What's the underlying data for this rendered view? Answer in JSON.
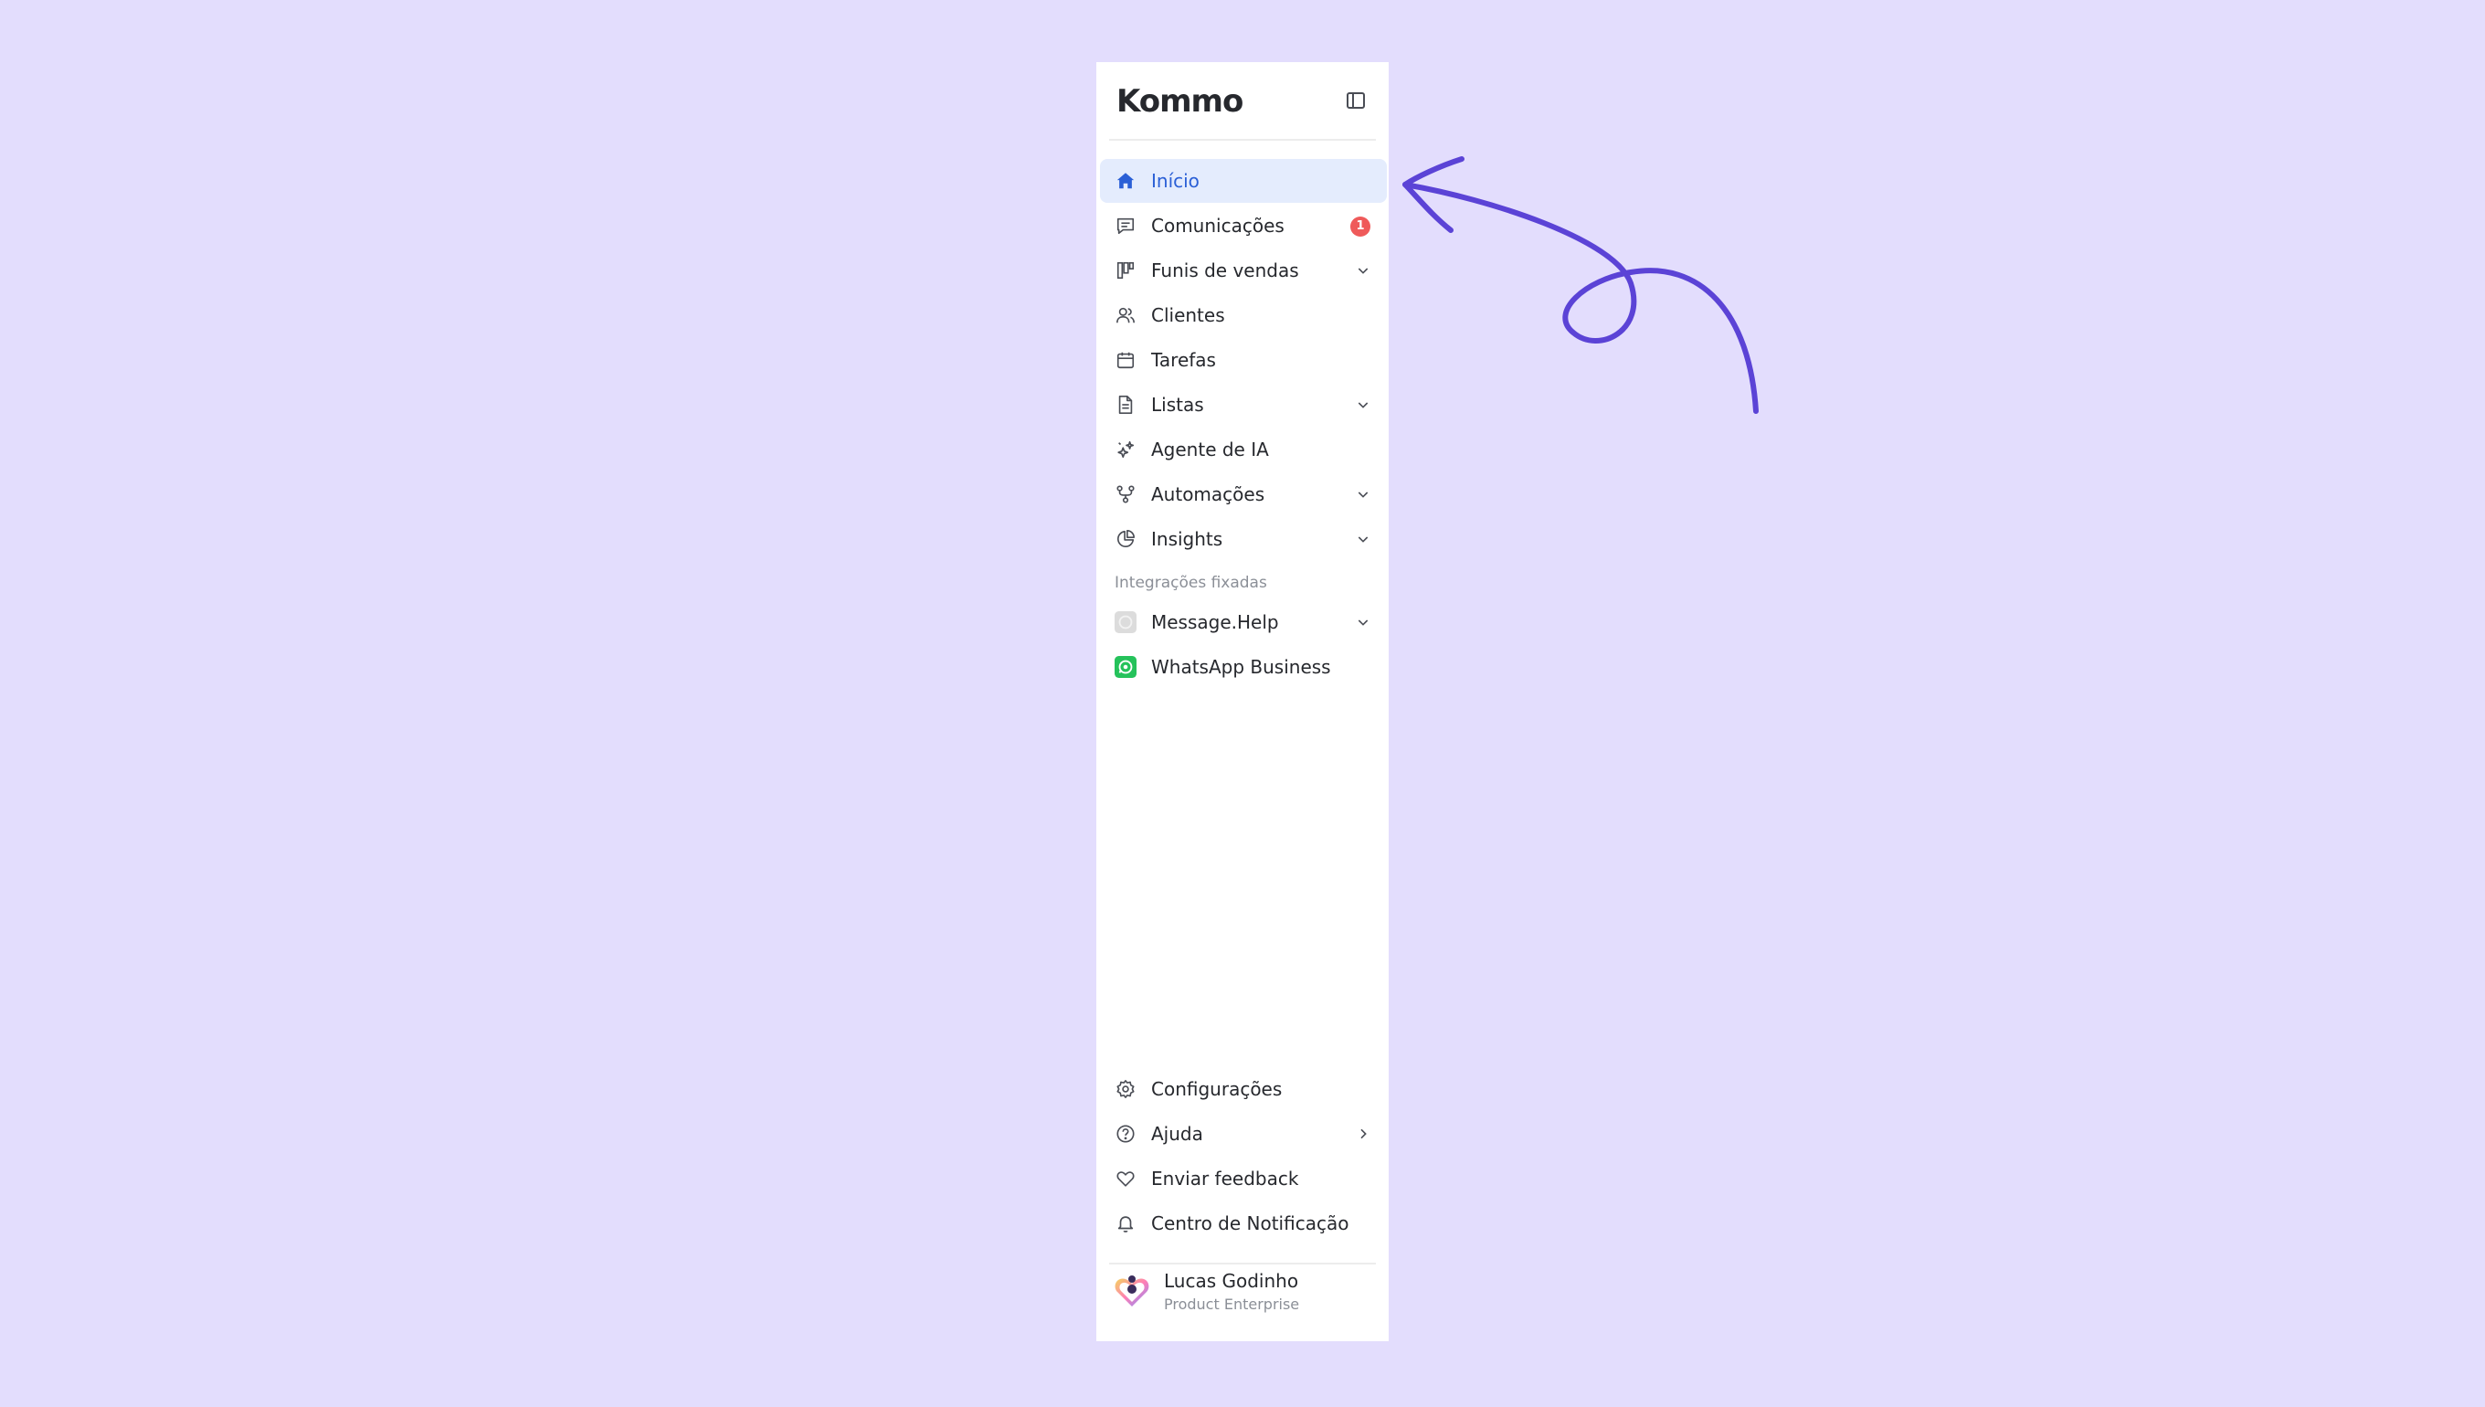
{
  "app": {
    "logo_text": "Kommo",
    "collapse_icon": "sidebar-collapse-icon"
  },
  "nav": {
    "items": [
      {
        "label": "Início",
        "icon": "home-icon",
        "active": true
      },
      {
        "label": "Comunicações",
        "icon": "chat-icon",
        "badge": "1"
      },
      {
        "label": "Funis de vendas",
        "icon": "pipeline-icon",
        "chevron": "chevron-down-icon"
      },
      {
        "label": "Clientes",
        "icon": "users-icon"
      },
      {
        "label": "Tarefas",
        "icon": "calendar-icon"
      },
      {
        "label": "Listas",
        "icon": "document-icon",
        "chevron": "chevron-down-icon"
      },
      {
        "label": "Agente de IA",
        "icon": "sparkles-icon"
      },
      {
        "label": "Automações",
        "icon": "automation-icon",
        "chevron": "chevron-down-icon"
      },
      {
        "label": "Insights",
        "icon": "pie-chart-icon",
        "chevron": "chevron-down-icon"
      }
    ]
  },
  "integrations": {
    "section_label": "Integrações fixadas",
    "items": [
      {
        "label": "Message.Help",
        "icon": "message-help-icon",
        "chevron": "chevron-down-icon"
      },
      {
        "label": "WhatsApp Business",
        "icon": "whatsapp-icon"
      }
    ]
  },
  "bottom_nav": {
    "items": [
      {
        "label": "Configurações",
        "icon": "gear-icon"
      },
      {
        "label": "Ajuda",
        "icon": "help-circle-icon",
        "chevron": "chevron-right-icon"
      },
      {
        "label": "Enviar feedback",
        "icon": "heart-icon"
      },
      {
        "label": "Centro de Notificação",
        "icon": "bell-icon"
      }
    ]
  },
  "user": {
    "name": "Lucas Godinho",
    "plan": "Product Enterprise",
    "avatar_icon": "avatar"
  },
  "colors": {
    "background": "#e3ddfd",
    "active_bg": "#e4ecfd",
    "active_text": "#2a5fd6",
    "badge": "#ef5a5a",
    "annotation_arrow": "#5b43d6",
    "whatsapp_green": "#25c25b"
  }
}
